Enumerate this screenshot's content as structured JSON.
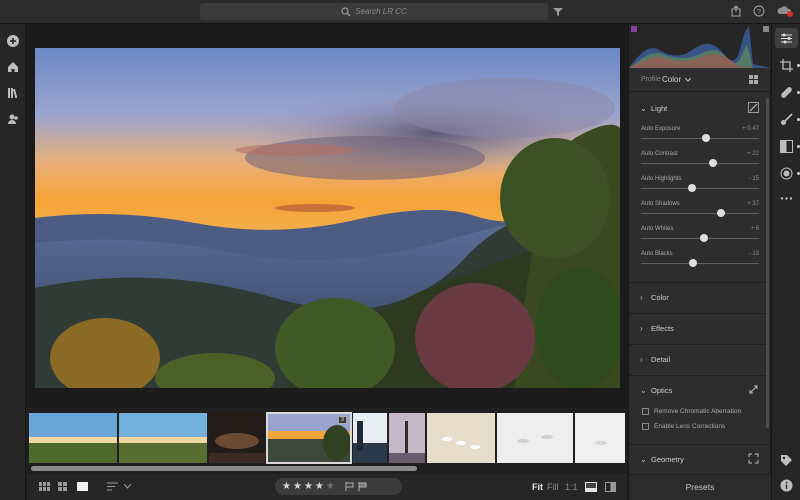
{
  "search": {
    "placeholder": "Search LR CC"
  },
  "top_icons": [
    "search-icon",
    "filter-icon",
    "share-icon",
    "help-icon",
    "cloud-sync-icon"
  ],
  "left_rail": {
    "icons": [
      "add-photos-icon",
      "home-icon",
      "library-icon",
      "people-icon"
    ]
  },
  "filmstrip": {
    "thumbnail_count": 9,
    "selected_index": 3,
    "selected_badge": "3"
  },
  "bottom_bar": {
    "rating": {
      "stars": 4,
      "max": 5
    },
    "zoom": {
      "fit": "Fit",
      "fill": "Fill",
      "one_to_one": "1:1",
      "active": "Fit"
    }
  },
  "panel": {
    "profile": {
      "label": "Profile",
      "value": "Color"
    },
    "light": {
      "title": "Light",
      "sliders": [
        {
          "label": "Auto Exposure",
          "value": "+ 0.47",
          "pos": 0.55
        },
        {
          "label": "Auto Contrast",
          "value": "+ 22",
          "pos": 0.61
        },
        {
          "label": "Auto Highlights",
          "value": "- 15",
          "pos": 0.43
        },
        {
          "label": "Auto Shadows",
          "value": "+ 37",
          "pos": 0.68
        },
        {
          "label": "Auto Whites",
          "value": "+ 6",
          "pos": 0.53
        },
        {
          "label": "Auto Blacks",
          "value": "- 13",
          "pos": 0.44
        }
      ]
    },
    "sections": {
      "color": "Color",
      "effects": "Effects",
      "detail": "Detail",
      "optics": "Optics",
      "geometry": "Geometry"
    },
    "optics_checks": {
      "chromatic": "Remove Chromatic Aberration",
      "lens": "Enable Lens Corrections"
    },
    "presets": "Presets"
  },
  "right_rail": {
    "icons": [
      "edit-sliders-icon",
      "crop-icon",
      "healing-icon",
      "brush-icon",
      "linear-gradient-icon",
      "radial-gradient-icon",
      "more-icon",
      "tag-icon",
      "info-icon"
    ]
  }
}
